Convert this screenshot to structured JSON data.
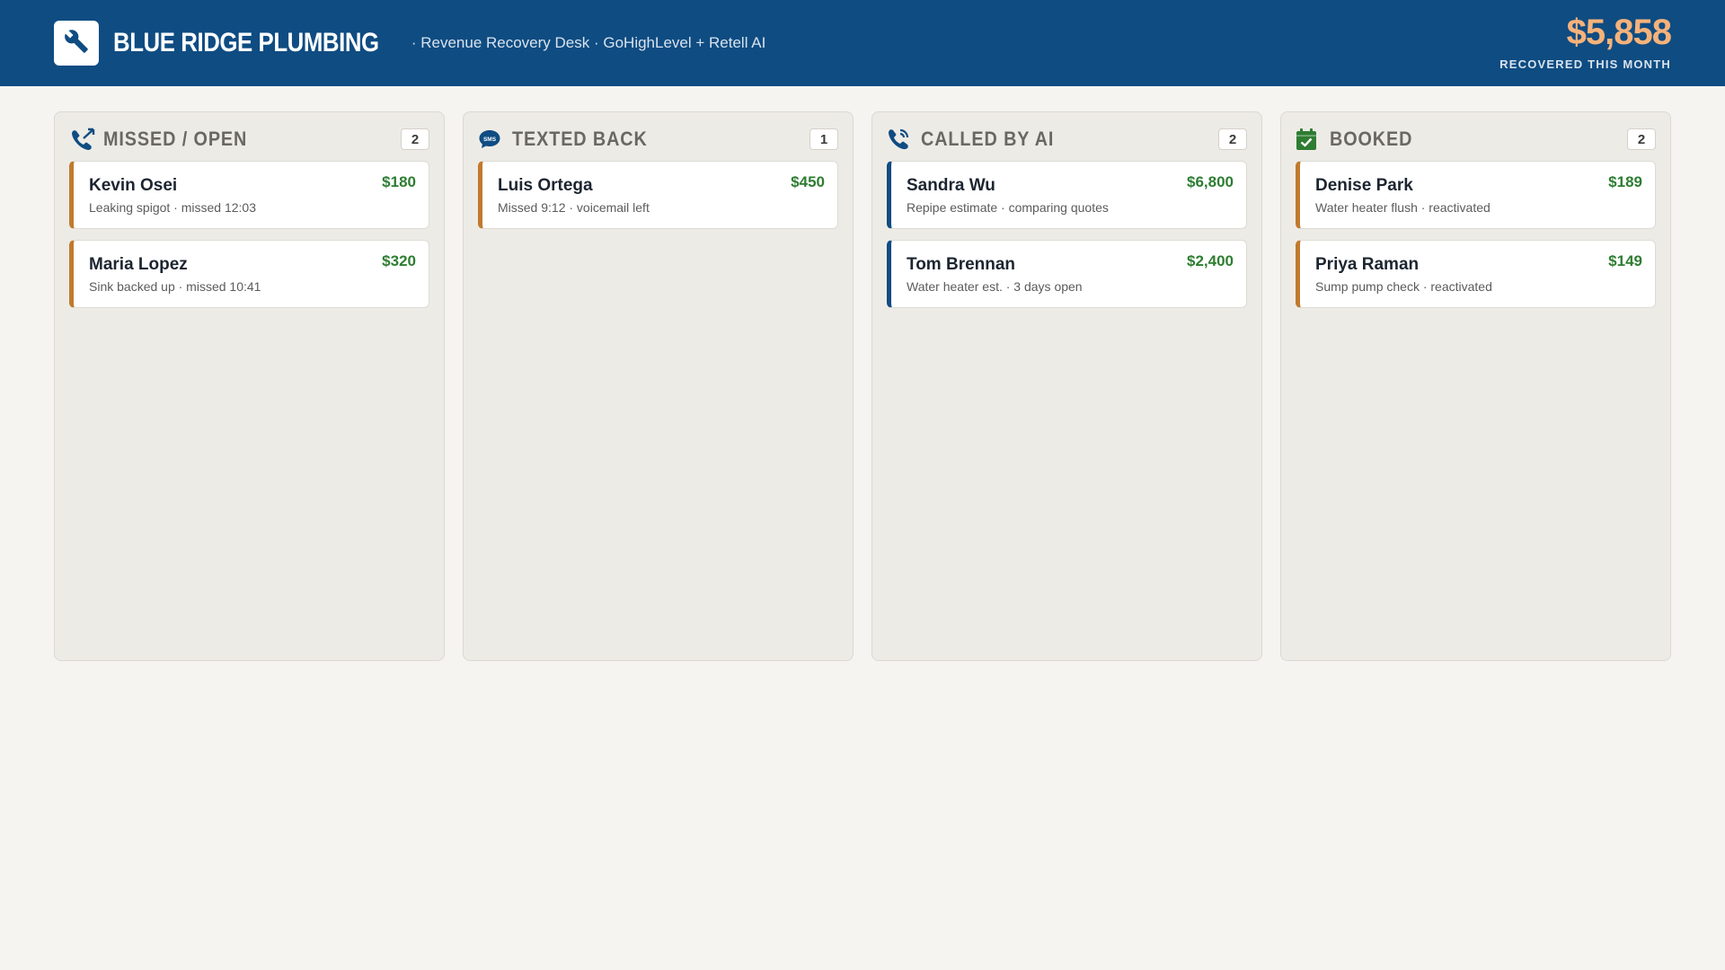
{
  "header": {
    "brand": "BLUE RIDGE PLUMBING",
    "tagline": "· Revenue Recovery Desk · GoHighLevel + Retell AI",
    "recovered_amount": "$5,858",
    "recovered_label": "RECOVERED THIS MONTH"
  },
  "columns": [
    {
      "title": "MISSED / OPEN",
      "count": "2",
      "icon": "missed-call-icon",
      "cards": [
        {
          "name": "Kevin Osei",
          "desc": "Leaking spigot · missed 12:03",
          "value": "$180"
        },
        {
          "name": "Maria Lopez",
          "desc": "Sink backed up · missed 10:41",
          "value": "$320"
        }
      ]
    },
    {
      "title": "TEXTED BACK",
      "count": "1",
      "icon": "sms-icon",
      "cards": [
        {
          "name": "Luis Ortega",
          "desc": "Missed 9:12 · voicemail left",
          "value": "$450"
        }
      ]
    },
    {
      "title": "CALLED BY AI",
      "count": "2",
      "icon": "phone-call-icon",
      "cards": [
        {
          "name": "Sandra Wu",
          "desc": "Repipe estimate · comparing quotes",
          "value": "$6,800"
        },
        {
          "name": "Tom Brennan",
          "desc": "Water heater est. · 3 days open",
          "value": "$2,400"
        }
      ]
    },
    {
      "title": "BOOKED",
      "count": "2",
      "icon": "calendar-check-icon",
      "cards": [
        {
          "name": "Denise Park",
          "desc": "Water heater flush · reactivated",
          "value": "$189"
        },
        {
          "name": "Priya Raman",
          "desc": "Sump pump check · reactivated",
          "value": "$149"
        }
      ]
    }
  ],
  "colors": {
    "header_bg": "#0f4c82",
    "accent_amount": "#f6b27a",
    "card_value": "#2e7d32",
    "orange_stripe": "#c07a2c",
    "blue_stripe": "#0f4c82"
  }
}
